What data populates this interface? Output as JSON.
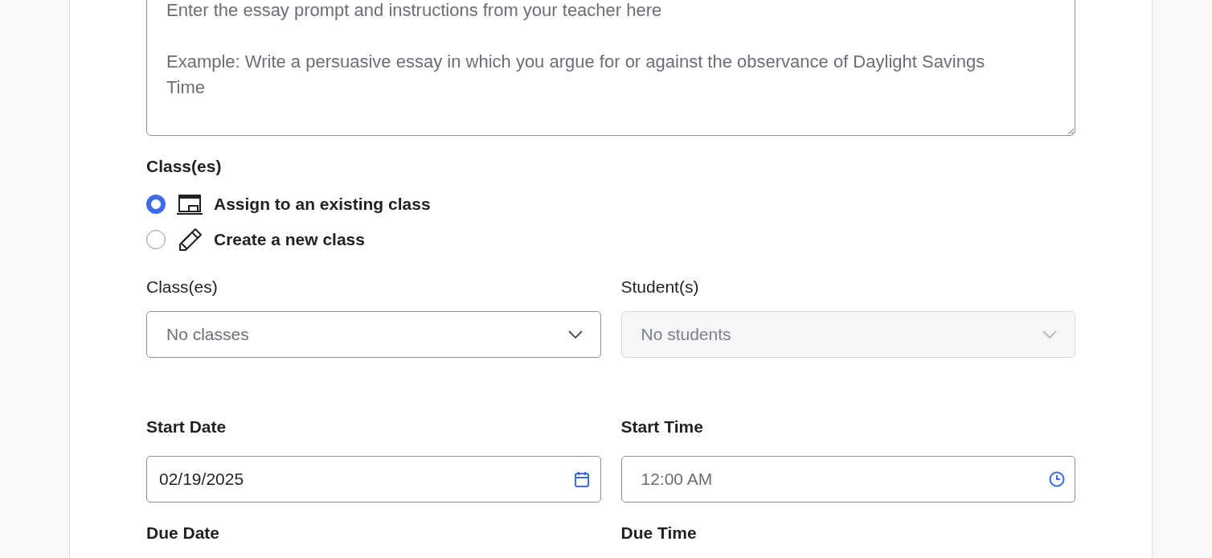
{
  "prompt": {
    "placeholder": "Enter the essay prompt and instructions from your teacher here\n\nExample: Write a persuasive essay in which you argue for or against the observance of Daylight Savings Time"
  },
  "class_section": {
    "label": "Class(es)",
    "options": [
      {
        "label": "Assign to an existing class",
        "selected": true
      },
      {
        "label": "Create a new class",
        "selected": false
      }
    ]
  },
  "selects": [
    {
      "label": "Class(es)",
      "placeholder": "No classes",
      "disabled": false
    },
    {
      "label": "Student(s)",
      "placeholder": "No students",
      "disabled": true
    }
  ],
  "schedule": [
    {
      "label": "Start Date",
      "kind": "date",
      "value": "02/19/2025"
    },
    {
      "label": "Start Time",
      "kind": "time",
      "placeholder": "12:00 AM"
    },
    {
      "label": "Due Date"
    },
    {
      "label": "Due Time"
    }
  ]
}
